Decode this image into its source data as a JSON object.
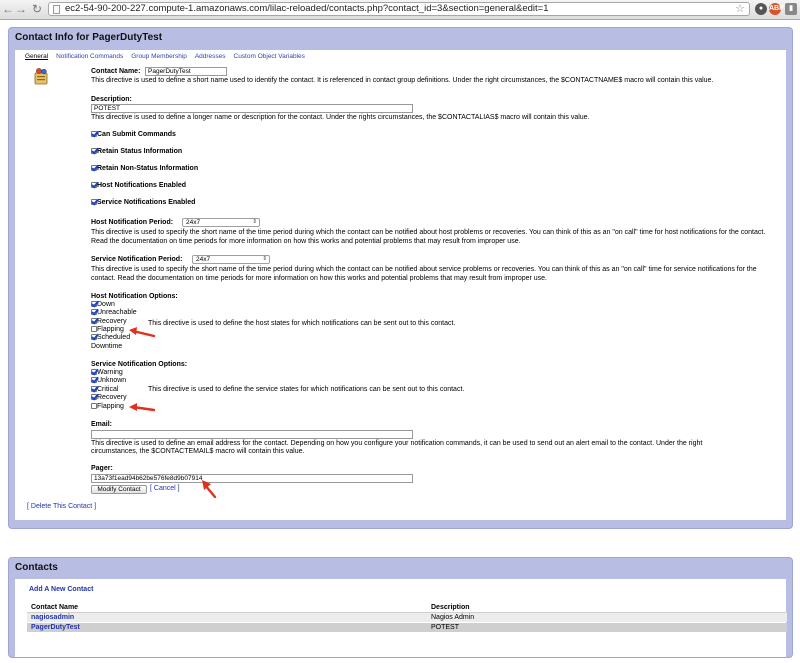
{
  "browser": {
    "url": "ec2-54-90-200-227.compute-1.amazonaws.com/lilac-reloaded/contacts.php?contact_id=3&section=general&edit=1"
  },
  "contact_panel": {
    "title": "Contact Info for PagerDutyTest",
    "tabs": [
      "General",
      "Notification Commands",
      "Group Membership",
      "Addresses",
      "Custom Object Variables"
    ],
    "contact_name": {
      "label": "Contact Name:",
      "value": "PagerDutyTest",
      "help": "This directive is used to define a short name used to identify the contact. It is referenced in contact group definitions. Under the right circumstances, the $CONTACTNAME$ macro will contain this value."
    },
    "description": {
      "label": "Description:",
      "value": "POTEST",
      "help": "This directive is used to define a longer name or description for the contact. Under the rights circumstances, the $CONTACTALIAS$ macro will contain this value."
    },
    "checkboxes": {
      "can_submit": "Can Submit Commands",
      "retain_status": "Retain Status Information",
      "retain_nonstatus": "Retain Non-Status Information",
      "host_notif_enabled": "Host Notifications Enabled",
      "service_notif_enabled": "Service Notifications Enabled"
    },
    "host_period": {
      "label": "Host Notification Period:",
      "value": "24x7",
      "help": "This directive is used to specify the short name of the time period during which the contact can be notified about host problems or recoveries. You can think of this as an \"on call\" time for host notifications for the contact. Read the documentation on time periods for more information on how this works and potential problems that may result from improper use."
    },
    "service_period": {
      "label": "Service Notification Period:",
      "value": "24x7",
      "help": "This directive is used to specify the short name of the time period during which the contact can be notified about service problems or recoveries. You can think of this as an \"on call\" time for service notifications for the contact. Read the documentation on time periods for more information on how this works and potential problems that may result from improper use."
    },
    "host_options": {
      "label": "Host Notification Options:",
      "down": "Down",
      "unreachable": "Unreachable",
      "recovery": "Recovery",
      "flapping": "Flapping",
      "scheduled_1": "Scheduled",
      "scheduled_2": "Downtime",
      "help": "This directive is used to define the host states for which notifications can be sent out to this contact."
    },
    "service_options": {
      "label": "Service Notification Options:",
      "warning": "Warning",
      "unknown": "Unknown",
      "critical": "Critical",
      "recovery": "Recovery",
      "flapping": "Flapping",
      "help": "This directive is used to define the service states for which notifications can be sent out to this contact."
    },
    "email": {
      "label": "Email:",
      "value": "",
      "help_1": "This directive is used to define an email address for the contact. Depending on how you configure your notification commands, it can be used to send out an alert email to the contact. Under the right",
      "help_2": "circumstances, the $CONTACTEMAIL$ macro will contain this value."
    },
    "pager": {
      "label": "Pager:",
      "value": "13a73f1ead94b62be576fe8d9b07914"
    },
    "modify_button": "Modify Contact",
    "cancel_link": "[ Cancel ]",
    "delete_link": "[ Delete This Contact ]"
  },
  "contacts_panel": {
    "title": "Contacts",
    "add_link": "Add A New Contact",
    "columns": [
      "Contact Name",
      "Description"
    ],
    "rows": [
      {
        "name": "nagiosadmin",
        "description": "Nagios Admin"
      },
      {
        "name": "PagerDutyTest",
        "description": "POTEST"
      }
    ]
  },
  "colors": {
    "panel_bg": "#b8bde3",
    "link": "#2233aa",
    "annotation_arrow": "#e03020"
  }
}
